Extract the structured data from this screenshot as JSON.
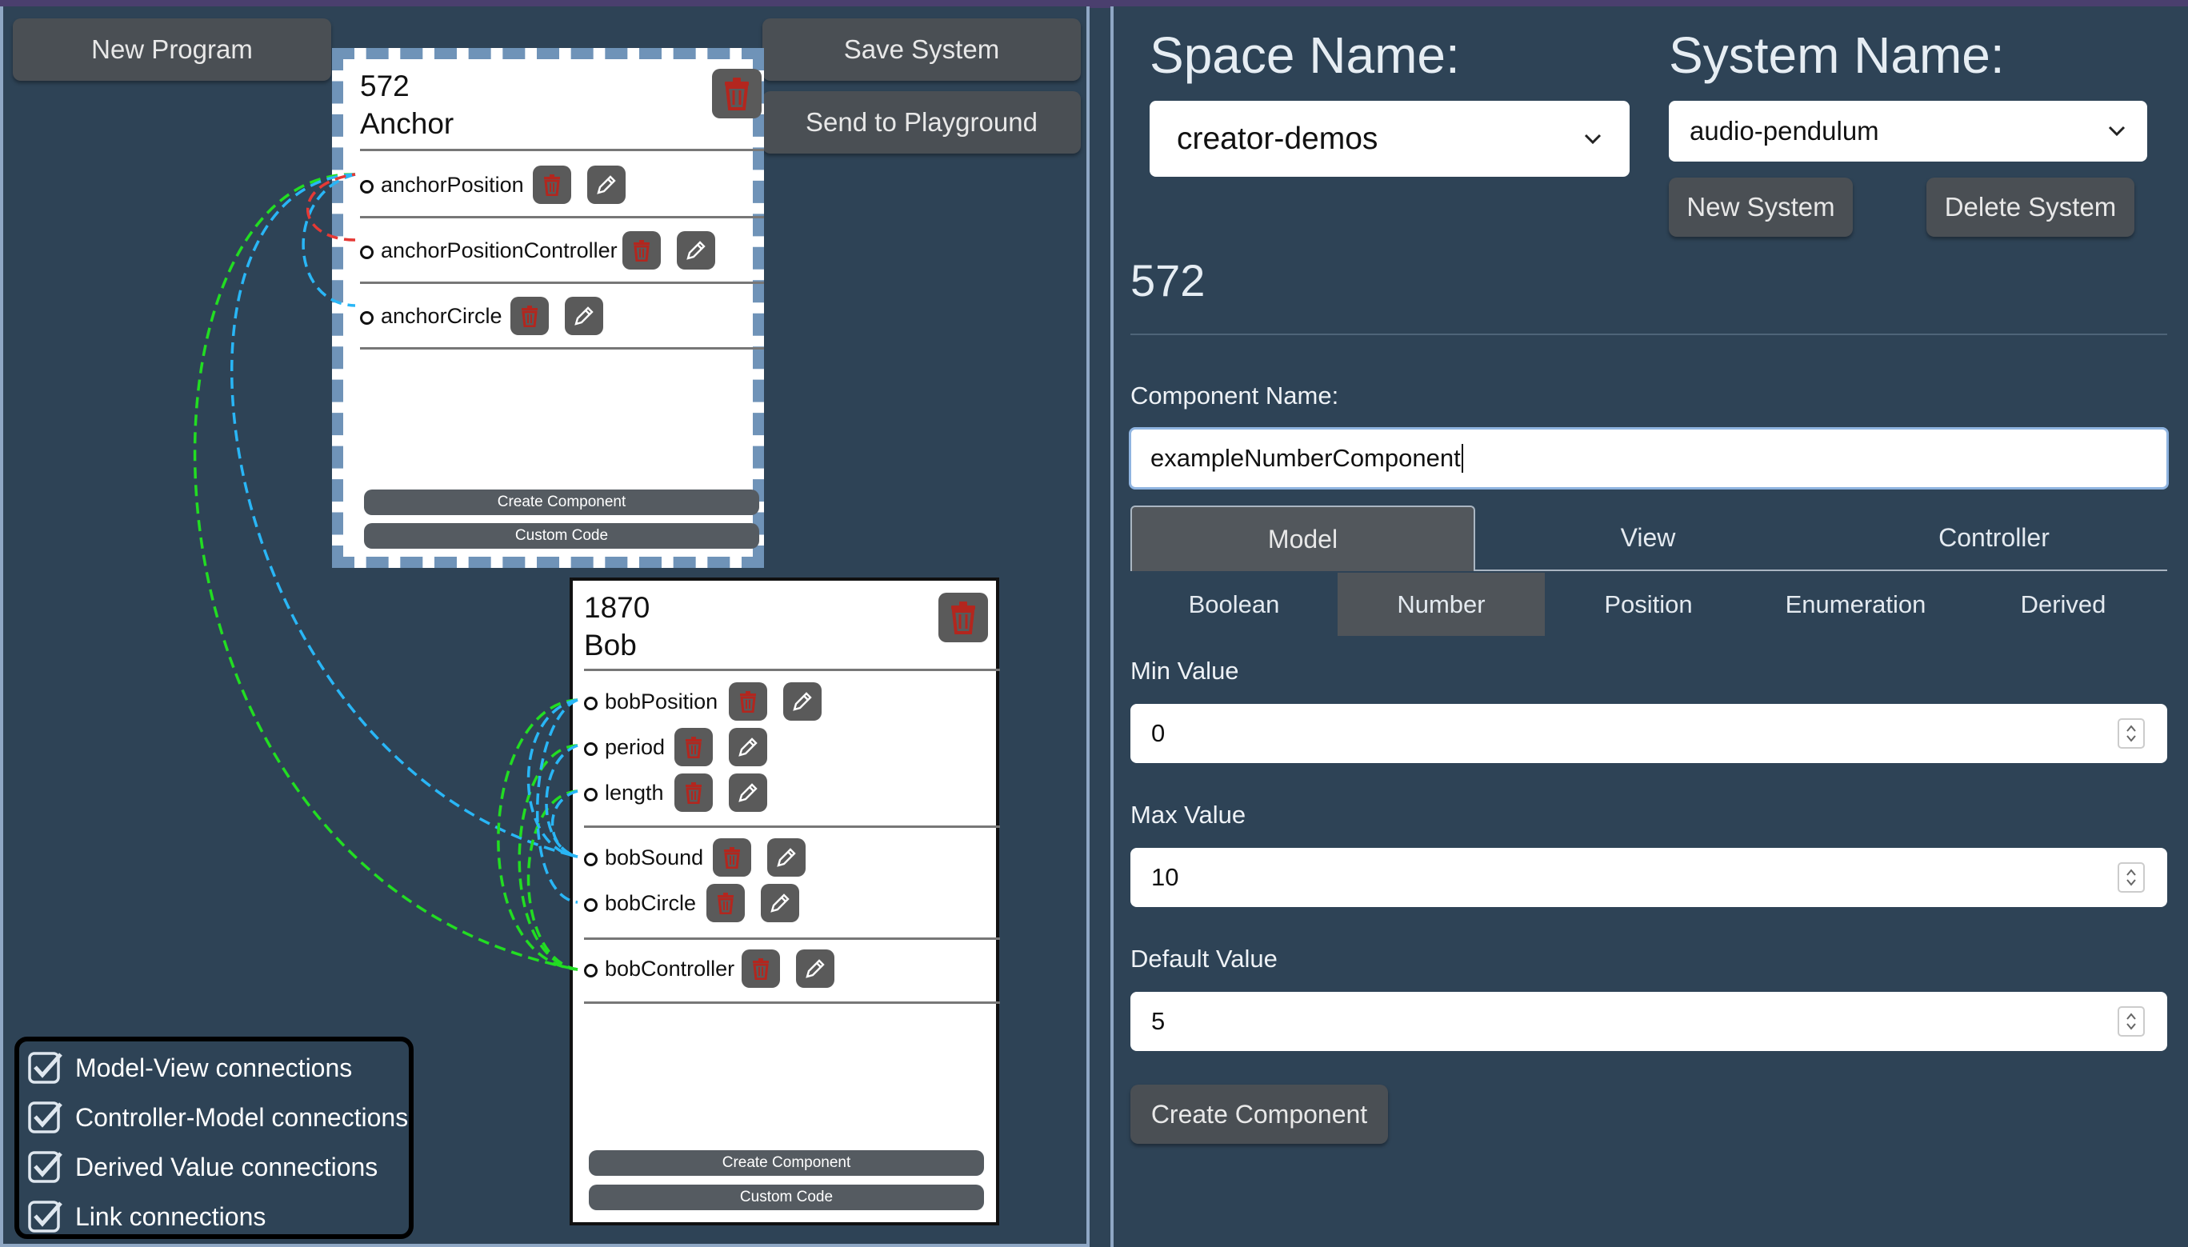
{
  "toolbar": {
    "new_program": "New Program",
    "save_system": "Save System",
    "send_to_playground": "Send to Playground"
  },
  "nodes": {
    "anchor": {
      "id": "572",
      "name": "Anchor",
      "rows": [
        "anchorPosition",
        "anchorPositionController",
        "anchorCircle"
      ],
      "create_component": "Create Component",
      "custom_code": "Custom Code"
    },
    "bob": {
      "id": "1870",
      "name": "Bob",
      "rows": [
        "bobPosition",
        "period",
        "length",
        "bobSound",
        "bobCircle",
        "bobController"
      ],
      "create_component": "Create Component",
      "custom_code": "Custom Code"
    }
  },
  "legend": {
    "items": [
      {
        "label": "Model-View connections",
        "checked": true
      },
      {
        "label": "Controller-Model connections",
        "checked": true
      },
      {
        "label": "Derived Value connections",
        "checked": true
      },
      {
        "label": "Link connections",
        "checked": true
      }
    ]
  },
  "colors": {
    "background": "#2e4356",
    "panel_border": "#8fa7c4",
    "model_view_wire": "#29b6f6",
    "controller_model_wire": "#e53935",
    "link_wire": "#22dd22",
    "delete_icon": "#b3261e"
  },
  "right": {
    "space_label": "Space Name:",
    "space_value": "creator-demos",
    "system_label": "System Name:",
    "system_value": "audio-pendulum",
    "new_system": "New System",
    "delete_system": "Delete System",
    "selected_id": "572",
    "component_name_label": "Component Name:",
    "component_name_value": "exampleNumberComponent",
    "tabs": [
      "Model",
      "View",
      "Controller"
    ],
    "active_tab": "Model",
    "subtabs": [
      "Boolean",
      "Number",
      "Position",
      "Enumeration",
      "Derived"
    ],
    "active_subtab": "Number",
    "min_label": "Min Value",
    "min_value": "0",
    "max_label": "Max Value",
    "max_value": "10",
    "default_label": "Default Value",
    "default_value": "5",
    "create_component": "Create Component"
  }
}
